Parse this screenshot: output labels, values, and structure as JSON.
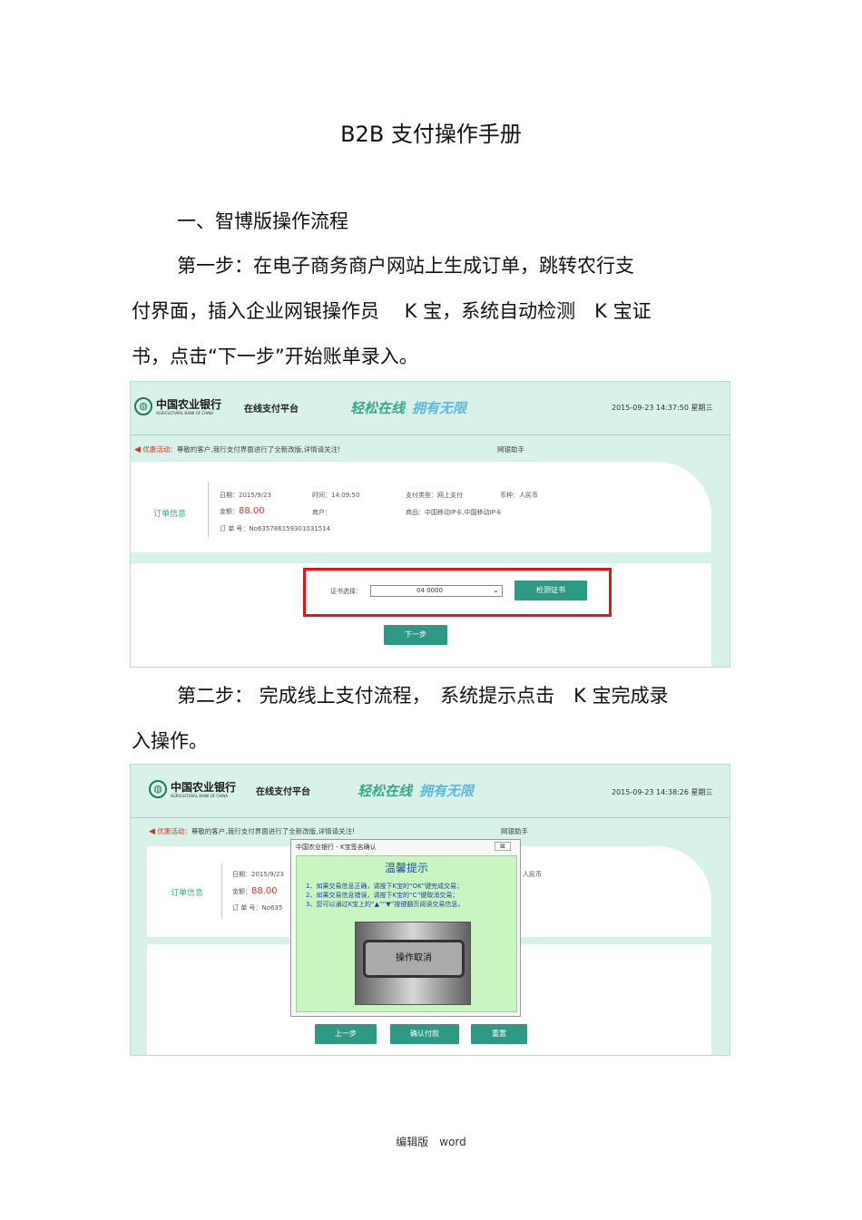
{
  "title": "B2B 支付操作手册",
  "section1": {
    "heading": "一、智博版操作流程"
  },
  "step1": {
    "line1": "第一步：在电子商务商户网站上生成订单，跳转农行支",
    "line2": "付界面，插入企业网银操作员　 K 宝，系统自动检测　K 宝证",
    "line3": "书，点击“下一步”开始账单录入。"
  },
  "step2": {
    "line1": "第二步： 完成线上支付流程，　系统提示点击　K 宝完成录",
    "line2": "入操作。"
  },
  "footer": "编辑版　word",
  "screenshot1": {
    "bank_name": "中国农业银行",
    "bank_name_en": "AGRICULTURAL BANK OF CHINA",
    "platform": "在线支付平台",
    "slogan_1": "轻松在线",
    "slogan_2": "拥有无限",
    "datetime": "2015-09-23 14:37:50 星期三",
    "notice_tag": "优惠活动：",
    "notice_text": "尊敬的客户,我行支付界面进行了全新改版,详情请关注!",
    "helper": "网银助手",
    "order_label": "订单信息",
    "date": "日期：2015/9/23",
    "time": "时间：14:09:50",
    "pay_type": "支付类型：网上支付",
    "currency": "币种：人民币",
    "amount_label": "金额：",
    "amount": "88.00",
    "merchant": "商户：",
    "goods": "商品：中国移动IP卡,中国移动IP卡",
    "order_no": "订 单 号：No635786159301031514",
    "cert_label": "证书选择：",
    "cert_value": "04 0000",
    "check_button": "检测证书",
    "next_button": "下一步"
  },
  "screenshot2": {
    "bank_name": "中国农业银行",
    "bank_name_en": "AGRICULTURAL BANK OF CHINA",
    "platform": "在线支付平台",
    "slogan_1": "轻松在线",
    "slogan_2": "拥有无限",
    "datetime": "2015-09-23 14:38:26 星期三",
    "notice_tag": "优惠活动：",
    "notice_text": "尊敬的客户,我行支付界面进行了全新改版,详情请关注!",
    "helper": "网银助手",
    "order_label": "订单信息",
    "date": "日期：2015/9/23",
    "currency": "人民币",
    "amount_label": "金额：",
    "amount": "88.00",
    "order_no": "订 单 号：No635",
    "dialog_title": "中国农业银行 - K宝签名确认",
    "dialog_heading": "温馨提示",
    "dialog_line1": "1、如果交易信息正确，请按下K宝的“OK”键完成交易；",
    "dialog_line2": "2、如果交易信息错误，请按下K宝的“C”键取消交易；",
    "dialog_line3": "3、您可以通过K宝上的“▲”“▼”按键翻页阅读交易信息。",
    "kbao_screen": "操作取消",
    "prev_button": "上一步",
    "confirm_button": "确认付款",
    "reset_button": "重置"
  }
}
